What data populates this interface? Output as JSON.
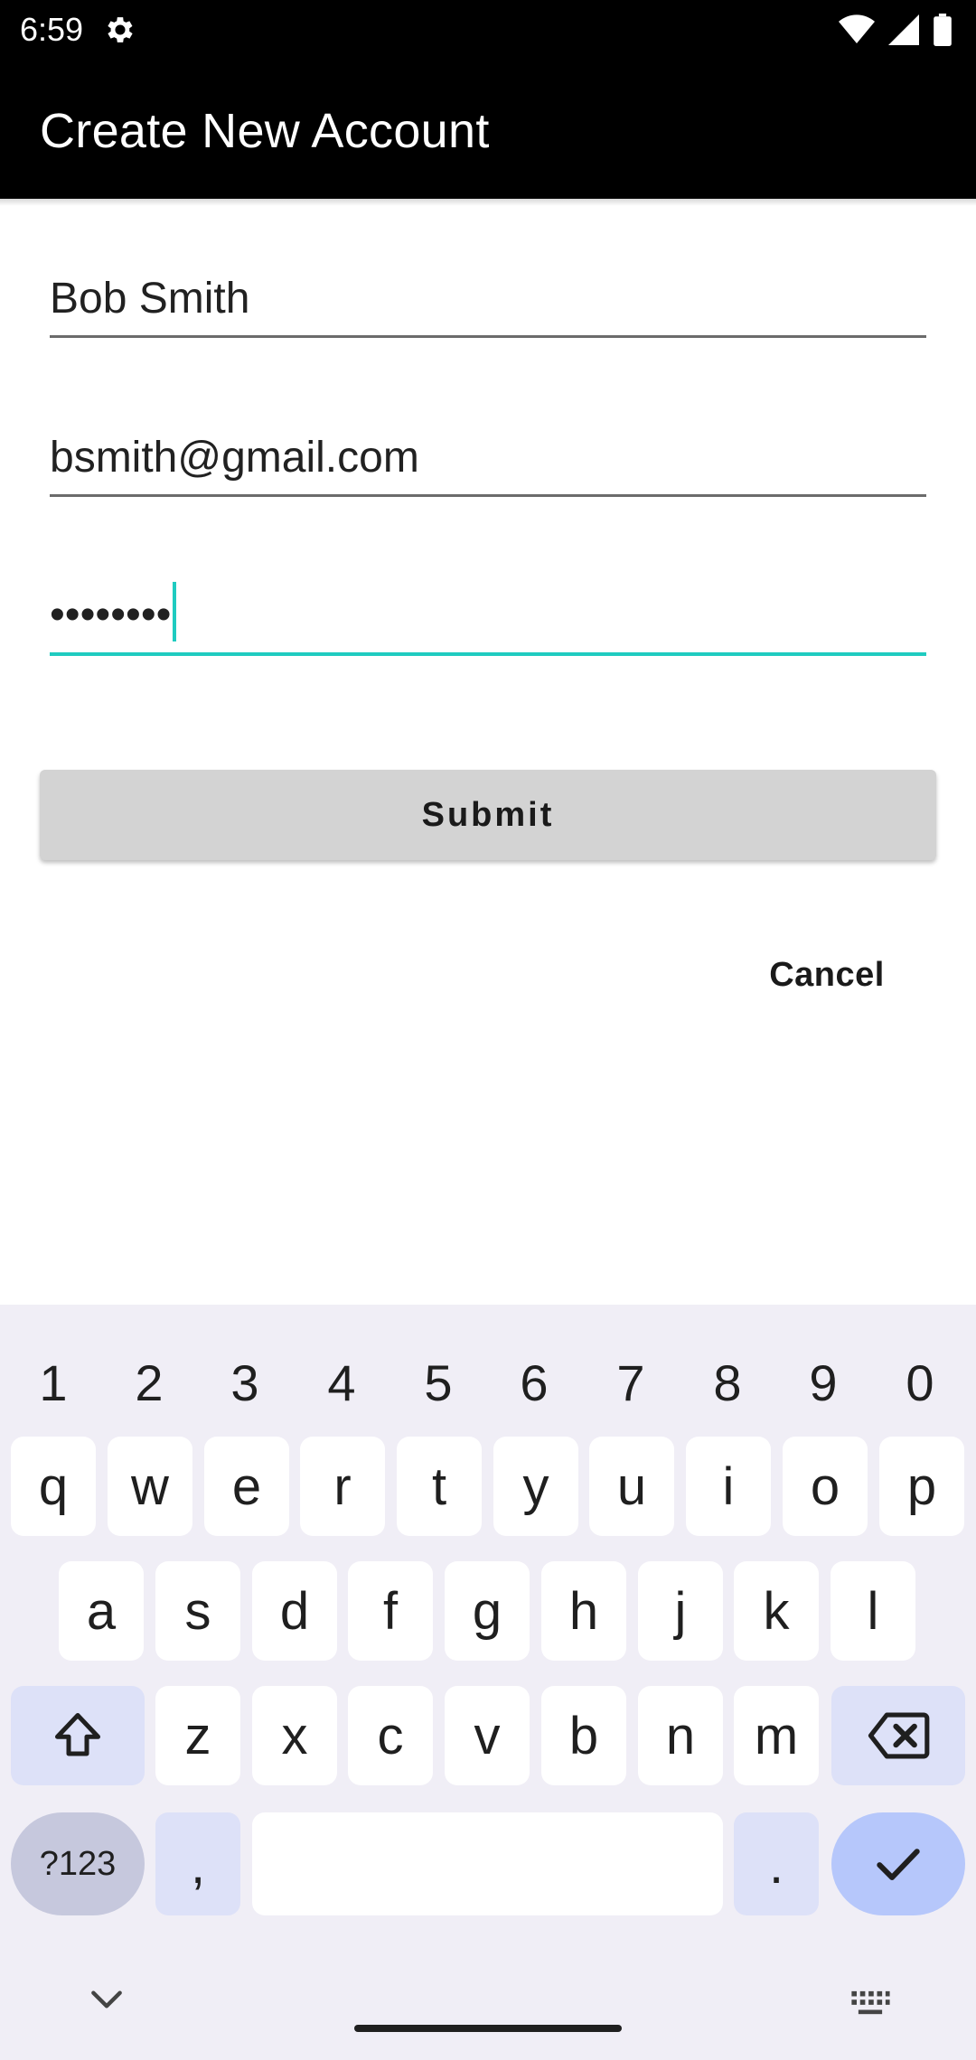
{
  "status_bar": {
    "time": "6:59",
    "icons": [
      "settings-icon",
      "wifi-icon",
      "cell-signal-icon",
      "battery-icon"
    ]
  },
  "app_bar": {
    "title": "Create New Account"
  },
  "form": {
    "name_value": "Bob Smith",
    "email_value": "bsmith@gmail.com",
    "password_value": "••••••••",
    "submit_label": "Submit",
    "cancel_label": "Cancel"
  },
  "colors": {
    "app_bar": "#000000",
    "focus_accent": "#1fcbc0",
    "submit_bg": "#d3d3d3",
    "keyboard_bg": "#f0eef6",
    "key_mod_bg": "#dde1f8",
    "key_enter_bg": "#b6c7fb"
  },
  "keyboard": {
    "number_row": [
      "1",
      "2",
      "3",
      "4",
      "5",
      "6",
      "7",
      "8",
      "9",
      "0"
    ],
    "row1": [
      "q",
      "w",
      "e",
      "r",
      "t",
      "y",
      "u",
      "i",
      "o",
      "p"
    ],
    "row2": [
      "a",
      "s",
      "d",
      "f",
      "g",
      "h",
      "j",
      "k",
      "l"
    ],
    "row3": [
      "z",
      "x",
      "c",
      "v",
      "b",
      "n",
      "m"
    ],
    "symbols_label": "?123",
    "comma_label": ",",
    "period_label": "."
  }
}
